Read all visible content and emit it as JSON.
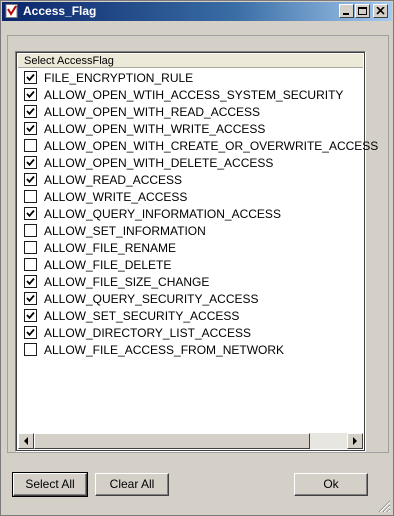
{
  "window": {
    "title": "Access_Flag",
    "app_icon": "app-icon"
  },
  "titlebar_buttons": {
    "minimize_icon": "minimize-icon",
    "maximize_icon": "maximize-icon",
    "close_icon": "close-icon"
  },
  "list": {
    "header": "Select AccessFlag",
    "items": [
      {
        "label": "FILE_ENCRYPTION_RULE",
        "checked": true
      },
      {
        "label": "ALLOW_OPEN_WTIH_ACCESS_SYSTEM_SECURITY",
        "checked": true
      },
      {
        "label": "ALLOW_OPEN_WITH_READ_ACCESS",
        "checked": true
      },
      {
        "label": "ALLOW_OPEN_WITH_WRITE_ACCESS",
        "checked": true
      },
      {
        "label": "ALLOW_OPEN_WITH_CREATE_OR_OVERWRITE_ACCESS",
        "checked": false
      },
      {
        "label": "ALLOW_OPEN_WITH_DELETE_ACCESS",
        "checked": true
      },
      {
        "label": "ALLOW_READ_ACCESS",
        "checked": true
      },
      {
        "label": "ALLOW_WRITE_ACCESS",
        "checked": false
      },
      {
        "label": "ALLOW_QUERY_INFORMATION_ACCESS",
        "checked": true
      },
      {
        "label": "ALLOW_SET_INFORMATION",
        "checked": false
      },
      {
        "label": "ALLOW_FILE_RENAME",
        "checked": false
      },
      {
        "label": "ALLOW_FILE_DELETE",
        "checked": false
      },
      {
        "label": "ALLOW_FILE_SIZE_CHANGE",
        "checked": true
      },
      {
        "label": "ALLOW_QUERY_SECURITY_ACCESS",
        "checked": true
      },
      {
        "label": "ALLOW_SET_SECURITY_ACCESS",
        "checked": true
      },
      {
        "label": "ALLOW_DIRECTORY_LIST_ACCESS",
        "checked": true
      },
      {
        "label": "ALLOW_FILE_ACCESS_FROM_NETWORK",
        "checked": false
      }
    ]
  },
  "buttons": {
    "select_all": "Select All",
    "clear_all": "Clear All",
    "ok": "Ok"
  }
}
